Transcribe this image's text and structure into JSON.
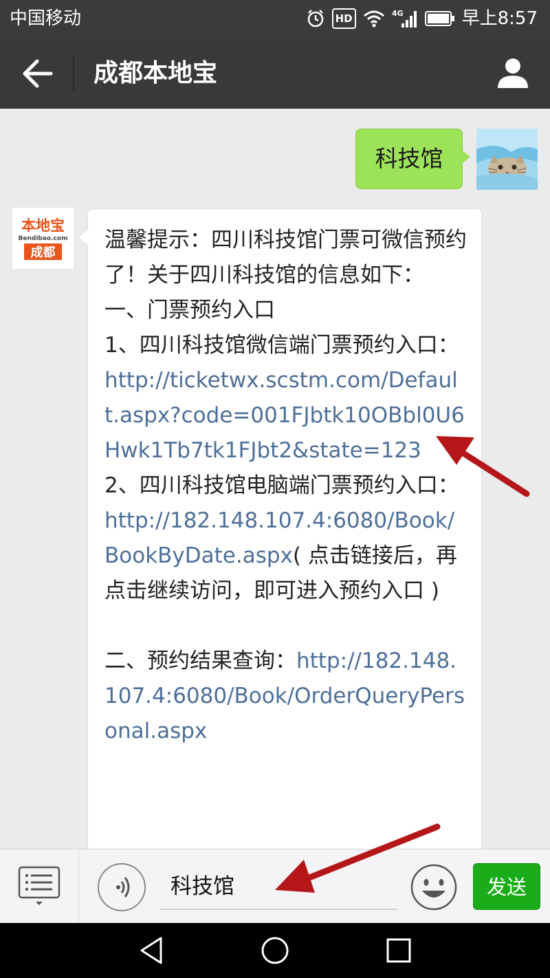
{
  "status_bar": {
    "carrier": "中国移动",
    "hd": "HD",
    "network": "4G",
    "time": "早上8:57"
  },
  "title_bar": {
    "title": "成都本地宝",
    "back_icon": "back-arrow-icon",
    "profile_icon": "person-icon"
  },
  "messages": {
    "sent": {
      "text": "科技馆"
    },
    "received": {
      "bot_logo_top": "本地宝",
      "bot_logo_site": "Bendibao.com",
      "bot_logo_city": "成都",
      "intro": "温馨提示：四川科技馆门票可微信预约了！关于四川科技馆的信息如下：",
      "section1_heading": "一、门票预约入口",
      "item1_prefix": "1、四川科技馆微信端门票预约入口：",
      "item1_link": "http://ticketwx.scstm.com/Default.aspx?code=001FJbtk10OBbl0U6Hwk1Tb7tk1FJbt2&state=123",
      "item2_prefix": "2、四川科技馆电脑端门票预约入口：",
      "item2_link": "http://182.148.107.4:6080/Book/BookByDate.aspx",
      "item2_suffix": "( 点击链接后，再点击继续访问，即可进入预约入口 )",
      "section2_prefix": "二、预约结果查询：",
      "section2_link": "http://182.148.107.4:6080/Book/OrderQueryPersonal.aspx"
    }
  },
  "input_bar": {
    "value": "科技馆",
    "send_label": "发送"
  },
  "colors": {
    "accent_green": "#1aad19",
    "bubble_green": "#9de35a",
    "link_blue": "#4e6f98",
    "annotation_red": "#b5161a"
  }
}
